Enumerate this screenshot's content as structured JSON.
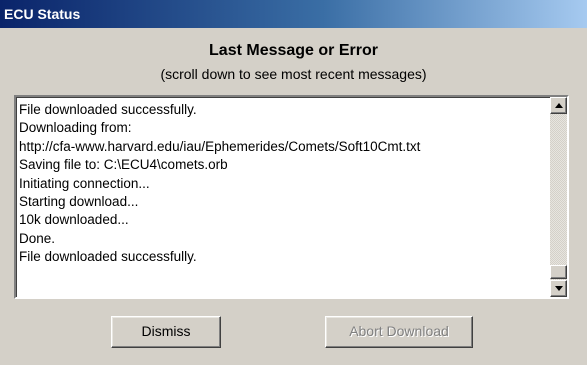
{
  "window": {
    "title": "ECU Status"
  },
  "header": {
    "title": "Last Message or Error",
    "subtitle": "(scroll down to see most recent messages)"
  },
  "log": {
    "lines": [
      "File downloaded successfully.",
      "Downloading from:",
      "http://cfa-www.harvard.edu/iau/Ephemerides/Comets/Soft10Cmt.txt",
      "Saving file to: C:\\ECU4\\comets.orb",
      "Initiating connection...",
      "Starting download...",
      "10k downloaded...",
      "Done.",
      "File downloaded successfully."
    ]
  },
  "buttons": {
    "dismiss_label": "Dismiss",
    "abort_label": "Abort Download",
    "abort_enabled": false
  },
  "colors": {
    "titlebar_start": "#0a246a",
    "titlebar_end": "#a6caf0",
    "face": "#d4d0c8",
    "disabled_text": "#808080"
  },
  "icons": {
    "scroll_up": "arrow-up-icon",
    "scroll_down": "arrow-down-icon"
  }
}
